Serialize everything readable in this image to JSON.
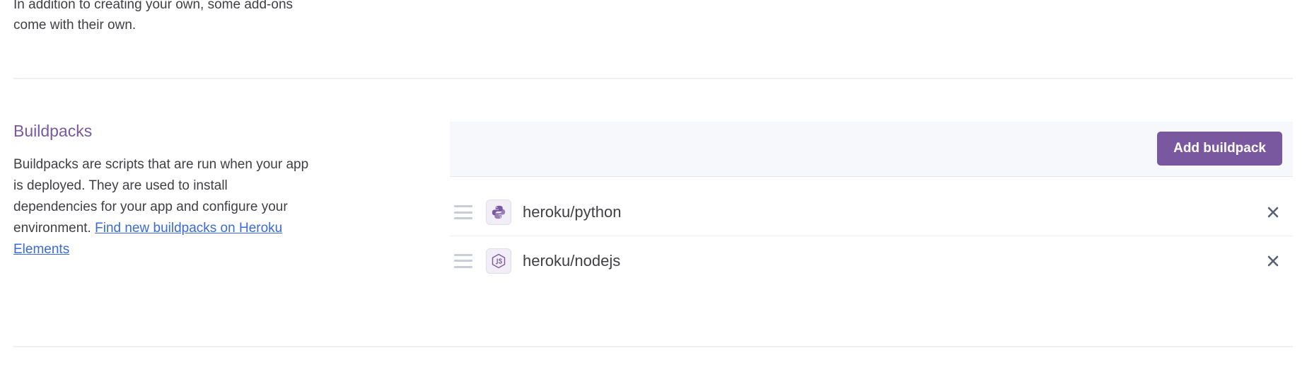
{
  "previous_section": {
    "description_tail": "In addition to creating your own, some add-ons come with their own."
  },
  "buildpacks": {
    "title": "Buildpacks",
    "description": "Buildpacks are scripts that are run when your app is deployed. They are used to install dependencies for your app and configure your environment.",
    "link_text": "Find new buildpacks on Heroku Elements",
    "add_button_label": "Add buildpack",
    "items": [
      {
        "name": "heroku/python",
        "icon": "python-icon"
      },
      {
        "name": "heroku/nodejs",
        "icon": "nodejs-icon"
      }
    ]
  },
  "colors": {
    "accent": "#79589f",
    "link": "#3a6ad8",
    "text": "#3f3f44"
  }
}
